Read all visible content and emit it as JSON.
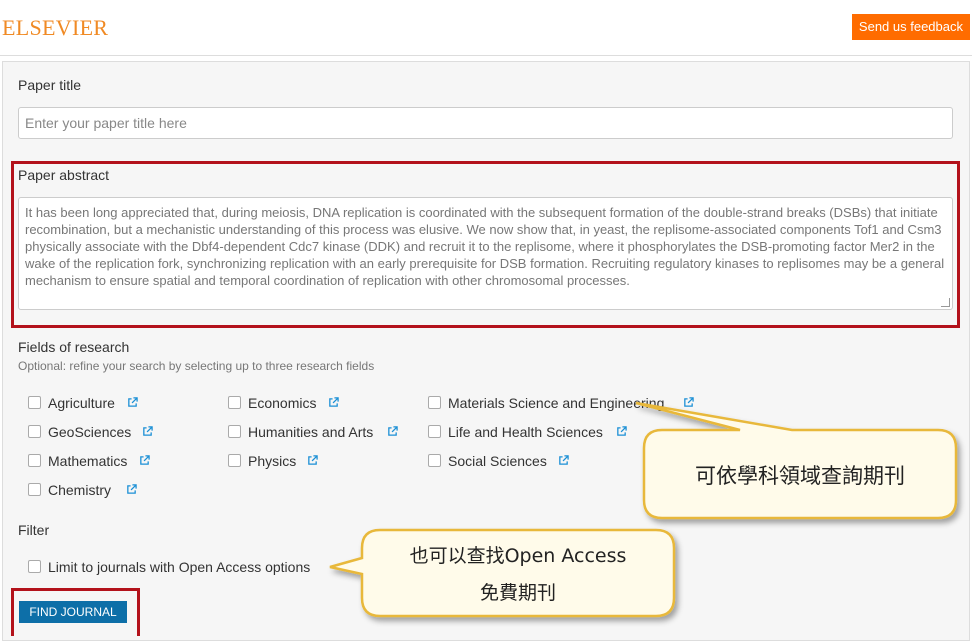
{
  "header": {
    "logo": "ELSEVIER",
    "feedback_label": "Send us feedback"
  },
  "form": {
    "title_label": "Paper title",
    "title_placeholder": "Enter your paper title here",
    "abstract_label": "Paper abstract",
    "abstract_text": "It has been long appreciated that, during meiosis, DNA replication is coordinated with the subsequent formation of the double-strand breaks (DSBs) that initiate recombination, but a mechanistic understanding of this process was elusive. We now show that, in yeast, the replisome-associated components Tof1 and Csm3 physically associate with the Dbf4-dependent Cdc7 kinase (DDK) and recruit it to the replisome, where it phosphorylates the DSB-promoting factor Mer2 in the wake of the replication fork, synchronizing replication with an early prerequisite for DSB formation. Recruiting regulatory kinases to replisomes may be a general mechanism to ensure spatial and temporal coordination of replication with other chromosomal processes.",
    "fields_label": "Fields of research",
    "fields_hint": "Optional: refine your search by selecting up to three research fields",
    "fields": [
      {
        "label": "Agriculture"
      },
      {
        "label": "Economics"
      },
      {
        "label": "Materials Science and Engineering"
      },
      {
        "label": "GeoSciences"
      },
      {
        "label": "Humanities and Arts"
      },
      {
        "label": "Life and Health Sciences"
      },
      {
        "label": "Mathematics"
      },
      {
        "label": "Physics"
      },
      {
        "label": "Social Sciences"
      },
      {
        "label": "Chemistry"
      }
    ],
    "filter_label": "Filter",
    "open_access_label": "Limit to journals with Open Access options",
    "find_label": "FIND JOURNAL"
  },
  "callouts": {
    "fields_note": "可依學科領域查詢期刊",
    "oa_line1": "也可以查找Open Access",
    "oa_line2": "免費期刊"
  },
  "colors": {
    "brand": "#f08a24",
    "feedback_bg": "#ff6c00",
    "highlight_border": "#b3121b",
    "find_button": "#0d6fa8",
    "callout_fill": "#fffbea",
    "callout_border": "#e8b83a"
  }
}
